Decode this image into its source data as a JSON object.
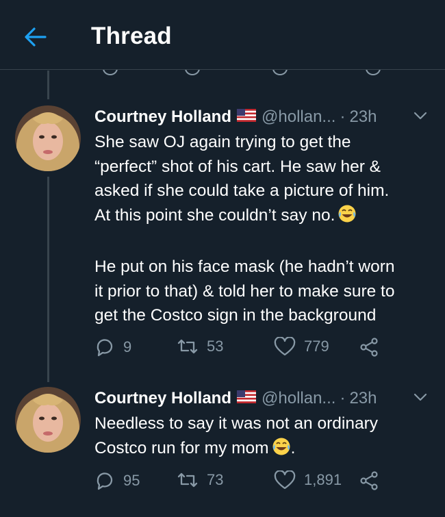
{
  "header": {
    "title": "Thread"
  },
  "tweets": [
    {
      "author": "Courtney Holland",
      "handle": "@hollan...",
      "separator": "·",
      "time": "23h",
      "text_lines": [
        "She saw OJ again trying to get the",
        "“perfect” shot of his cart. He saw her &",
        "asked if she could take a picture of him.",
        "At this point she couldn’t say no."
      ],
      "text_lines_2": [
        "He put on his face mask (he hadn’t worn",
        "it prior to that) & told her to make sure to",
        "get the Costco sign in the background"
      ],
      "replies": "9",
      "retweets": "53",
      "likes": "779"
    },
    {
      "author": "Courtney Holland",
      "handle": "@hollan...",
      "separator": "·",
      "time": "23h",
      "text_lines": [
        "Needless to say it was not an ordinary",
        "Costco run for my mom"
      ],
      "replies": "95",
      "retweets": "73",
      "likes": "1,891"
    }
  ],
  "icons": {
    "back": "arrow-left-icon",
    "flag": "us-flag-icon",
    "emoji": "tears-of-joy-emoji",
    "reply": "reply-icon",
    "retweet": "retweet-icon",
    "like": "heart-icon",
    "share": "share-icon",
    "caret": "chevron-down-icon"
  },
  "colors": {
    "background": "#15202b",
    "accent": "#1da1f2",
    "secondary_text": "#8899a6",
    "divider": "#38444d"
  }
}
